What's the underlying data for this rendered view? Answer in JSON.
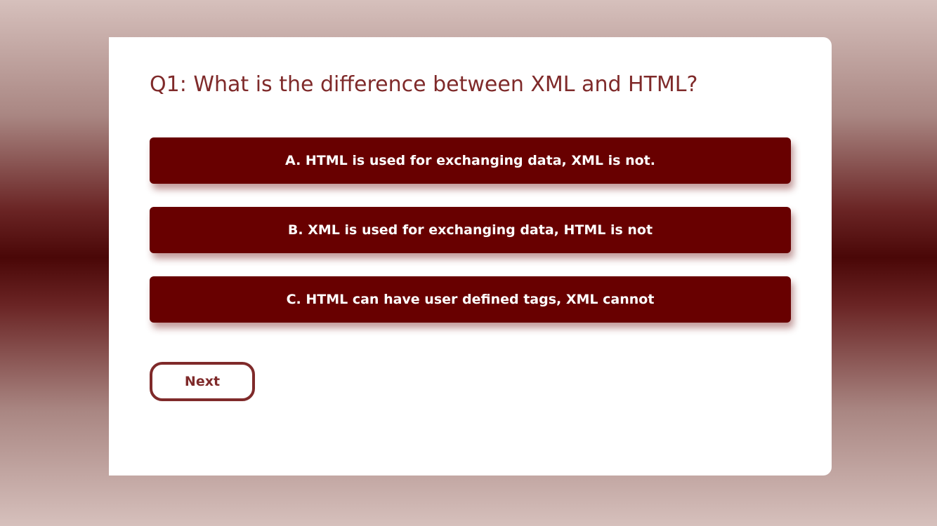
{
  "quiz": {
    "question": "Q1: What is the difference between XML and HTML?",
    "options": [
      {
        "label": "A. HTML is used for exchanging data, XML is not."
      },
      {
        "label": "B. XML is used for exchanging data, HTML is not"
      },
      {
        "label": "C. HTML can have user defined tags, XML cannot"
      }
    ],
    "next_label": "Next"
  },
  "colors": {
    "accent": "#7f2a2a",
    "option_background": "#680000",
    "card_background": "#ffffff"
  }
}
